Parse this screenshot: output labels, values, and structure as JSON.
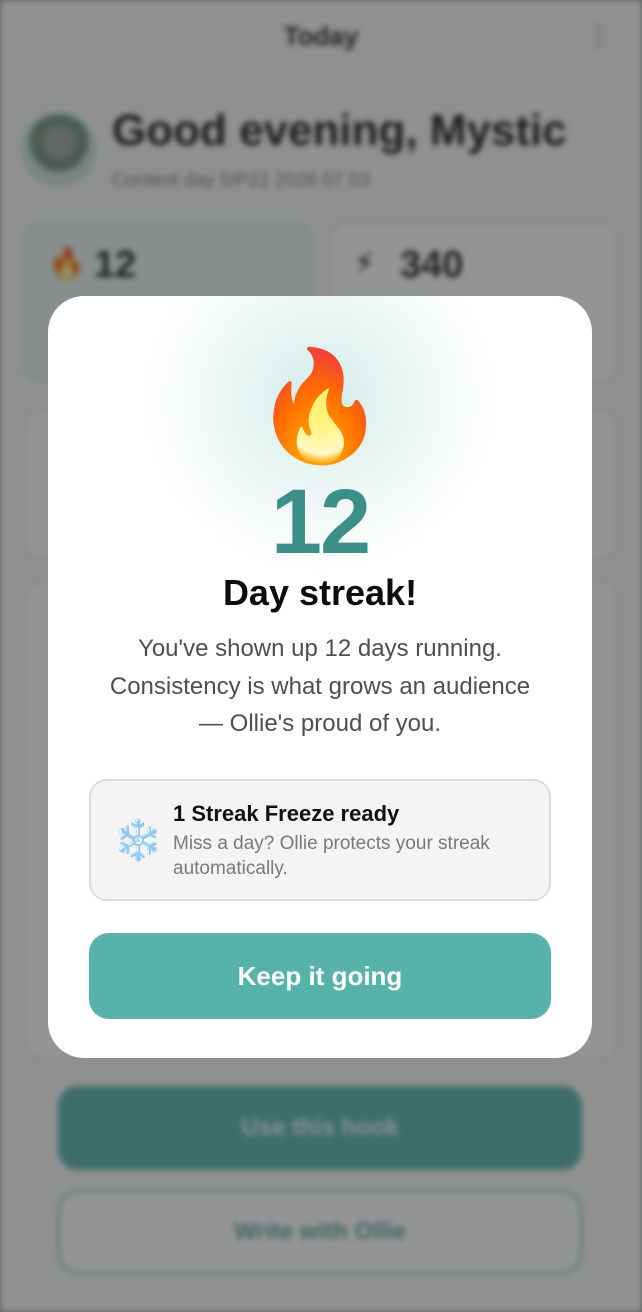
{
  "app": {
    "top_bar": {
      "title": "Today",
      "menu_icon": "more-vertical-icon"
    },
    "greeting": "Good evening, Mystic",
    "subline": "Content day 5/P22 2026 07 03",
    "stats": [
      {
        "icon": "fire-icon",
        "icon_glyph": "🔥",
        "value": "12"
      },
      {
        "icon": "sparkle-icon",
        "icon_glyph": "⚡",
        "value": "340"
      }
    ],
    "buttons": {
      "primary_label": "Use this hook",
      "secondary_label": "Write with Ollie"
    }
  },
  "modal": {
    "icon": "fire-icon",
    "icon_glyph": "🔥",
    "streak_count": "12",
    "title": "Day streak!",
    "body": "You've shown up 12 days running. Consistency is what grows an audience — Ollie's proud of you.",
    "freeze": {
      "icon": "snowflake-icon",
      "icon_glyph": "❄️",
      "title": "1 Streak Freeze ready",
      "text": "Miss a day? Ollie protects your streak automatically."
    },
    "cta_label": "Keep it going"
  },
  "colors": {
    "accent": "#57b2aa",
    "streak_number": "#3c8f88",
    "scrim": "#282c2b"
  }
}
